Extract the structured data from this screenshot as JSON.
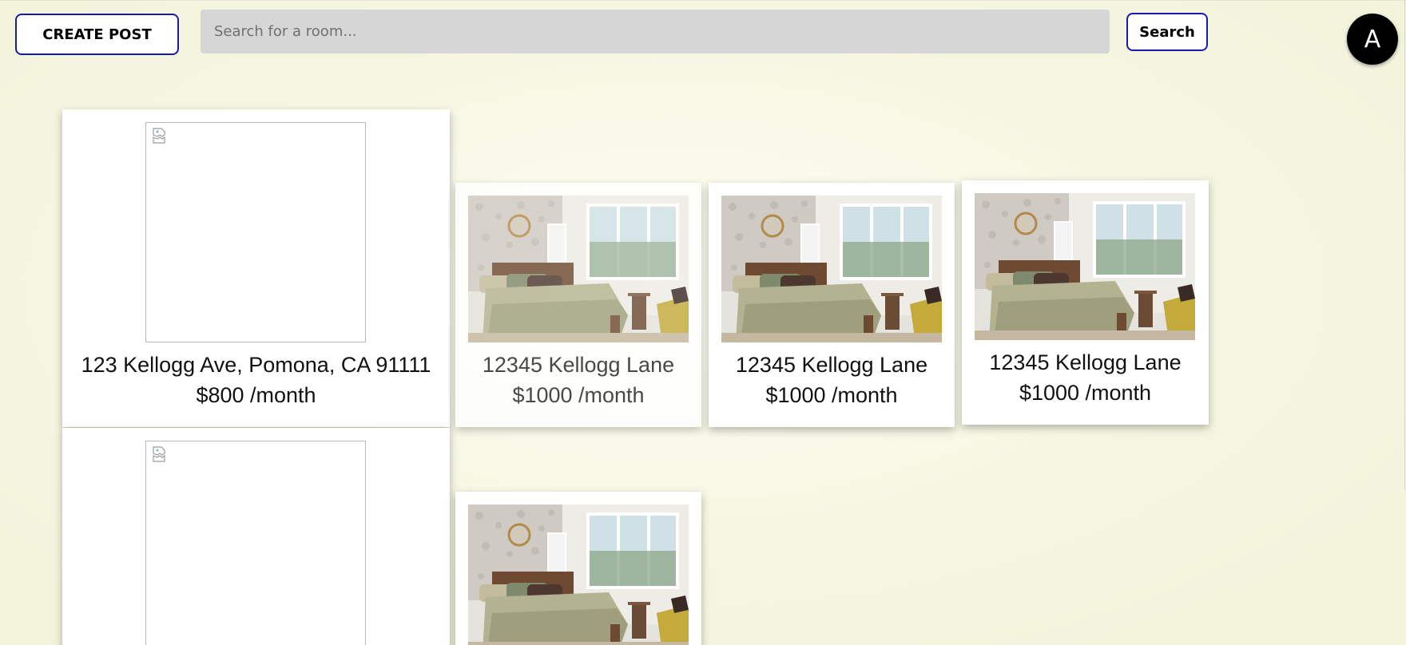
{
  "header": {
    "create_post_label": "CREATE POST",
    "search_placeholder": "Search for a room...",
    "search_label": "Search",
    "avatar_initial": "A"
  },
  "listings": [
    {
      "address": "123 Kellogg Ave, Pomona, CA 91111",
      "price": "$800 /month",
      "image": "broken"
    },
    {
      "address": "12345 Kellogg Lane",
      "price": "$1000 /month",
      "image": "bedroom-photo"
    },
    {
      "address": "12345 Kellogg Lane",
      "price": "$1000 /month",
      "image": "bedroom-photo"
    },
    {
      "address": "12345 Kellogg Lane",
      "price": "$1000 /month",
      "image": "bedroom-photo"
    },
    {
      "address": "",
      "price": "",
      "image": "broken"
    },
    {
      "address": "",
      "price": "",
      "image": "bedroom-photo"
    }
  ],
  "colors": {
    "accent_border": "#1a1aa8",
    "search_bg": "#d6d6d6",
    "page_bg": "#f3f5dd"
  }
}
